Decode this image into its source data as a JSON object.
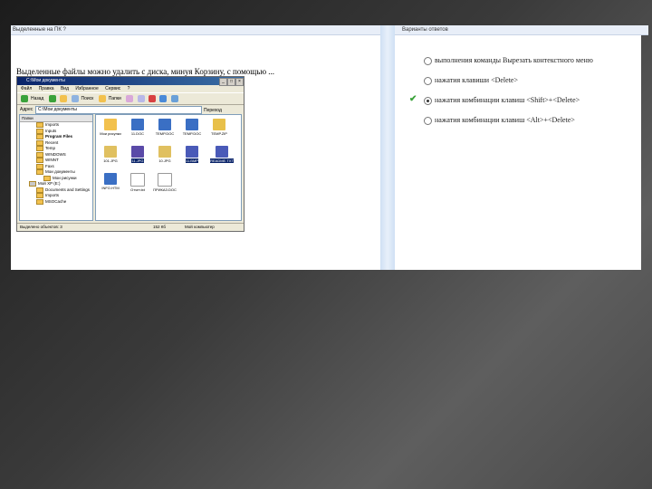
{
  "left_header": "Выделенные на ПК ?",
  "right_header": "Варианты ответов",
  "question": "Выделенные файлы можно удалить с диска, минуя Корзину, с помощью ...",
  "explorer": {
    "title": "C:\\Мои документы",
    "menu": [
      "Файл",
      "Правка",
      "Вид",
      "Избранное",
      "Сервис",
      "?"
    ],
    "toolbar": [
      "Назад",
      "Поиск",
      "Папки"
    ],
    "address_label": "Адрес",
    "address_value": "C:\\Мои документы",
    "go_label": "Переход",
    "tree_header": "Папки",
    "tree_items": [
      "Imports",
      "Inputs",
      "Program Files",
      "Recent",
      "Temp",
      "WINDOWS",
      "WINNT",
      "Faxs",
      "Мои документы",
      "Мои рисунки",
      "Мой XP (E:)",
      "Documents and Settings",
      "Imports",
      "MSOCache"
    ],
    "files": [
      {
        "label": "Мои рисунки",
        "color": "#f2c14e",
        "selected": false
      },
      {
        "label": "11.DOC",
        "color": "#3a6fc4",
        "selected": false
      },
      {
        "label": "TEMP.DOC",
        "color": "#3a6fc4",
        "selected": false
      },
      {
        "label": "TEMP.DOC",
        "color": "#3a6fc4",
        "selected": false
      },
      {
        "label": "TEMP.ZIP",
        "color": "#e8c04a",
        "selected": false
      },
      {
        "label": "101.JPG",
        "color": "#e0c060",
        "selected": false
      },
      {
        "label": "11.JPG",
        "color": "#5a4aa8",
        "selected": true
      },
      {
        "label": "10.JPG",
        "color": "#e0c060",
        "selected": false
      },
      {
        "label": "11.BMP",
        "color": "#4a5ab8",
        "selected": true
      },
      {
        "label": "README.TXT",
        "color": "#4a5ab8",
        "selected": true
      },
      {
        "label": "INFO.HTM",
        "color": "#3a6fc4",
        "selected": false
      },
      {
        "label": "Отчет.txt",
        "color": "#ffffff",
        "selected": false
      },
      {
        "label": "ПРИКАЗ.DOC",
        "color": "#ffffff",
        "selected": false
      }
    ],
    "status_left": "Выделено объектов: 3",
    "status_mid": "152 Кб",
    "status_right": "Мой компьютер"
  },
  "answers": [
    {
      "text": "выполнения команды Вырезать контекстного меню",
      "selected": false,
      "correct": false
    },
    {
      "text": "нажатия клавиши <Delete>",
      "selected": false,
      "correct": false
    },
    {
      "text": "нажатия комбинации клавиш <Shift>+<Delete>",
      "selected": true,
      "correct": true
    },
    {
      "text": "нажатия комбинации клавиш <Alt>+<Delete>",
      "selected": false,
      "correct": false
    }
  ],
  "check_mark": "✔"
}
